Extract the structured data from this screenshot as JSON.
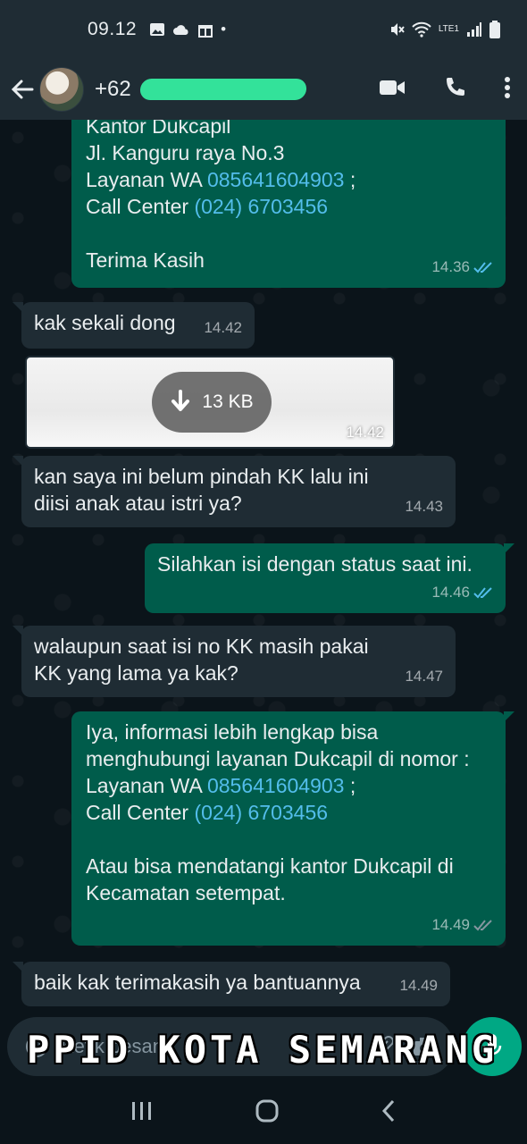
{
  "status_bar": {
    "time": "09.12",
    "network_label": "LTE1"
  },
  "header": {
    "contact_prefix": "+62"
  },
  "messages": [
    {
      "lines": [
        "Kantor Dukcapil",
        "Jl. Kanguru raya No.3"
      ],
      "wa_label": "Layanan WA ",
      "wa_number": "085641604903",
      "wa_suffix": " ;",
      "cc_label": "Call Center ",
      "cc_number": "(024) 6703456",
      "closing": "Terima Kasih",
      "time": "14.36"
    },
    {
      "text": "kak sekali dong",
      "time": "14.42"
    },
    {
      "file_size": "13 KB",
      "time": "14.42"
    },
    {
      "text": "kan saya ini belum pindah KK lalu ini diisi anak atau istri ya?",
      "time": "14.43"
    },
    {
      "text": "Silahkan isi dengan status saat ini.",
      "time": "14.46"
    },
    {
      "text": "walaupun saat isi no KK masih pakai KK yang lama ya kak?",
      "time": "14.47"
    },
    {
      "intro": "Iya, informasi lebih lengkap bisa menghubungi layanan Dukcapil di nomor :",
      "wa_label": "Layanan WA ",
      "wa_number": "085641604903",
      "wa_suffix": " ;",
      "cc_label": "Call Center ",
      "cc_number": "(024) 6703456",
      "closing": "Atau bisa mendatangi kantor Dukcapil di Kecamatan setempat.",
      "time": "14.49"
    },
    {
      "text": "baik kak terimakasih ya bantuannya",
      "time": "14.49"
    }
  ],
  "input": {
    "placeholder": "Ketik pesan"
  },
  "watermark": "PPID KOTA SEMARANG",
  "colors": {
    "outgoing_bubble": "#005c4b",
    "incoming_bubble": "#1f2c34",
    "link": "#53bdeb",
    "read_ticks": "#53bdeb",
    "accent": "#00a884"
  }
}
